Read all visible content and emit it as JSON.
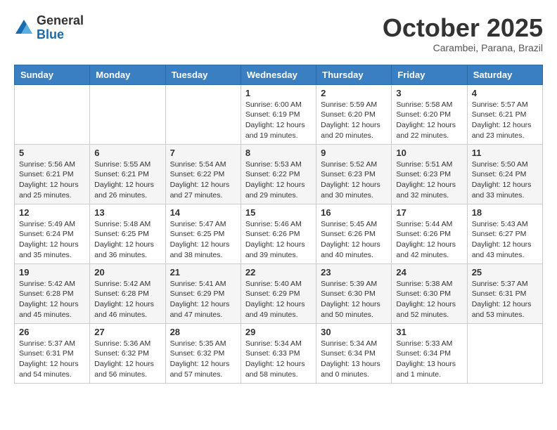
{
  "header": {
    "logo": {
      "general": "General",
      "blue": "Blue"
    },
    "title": "October 2025",
    "location": "Carambei, Parana, Brazil"
  },
  "weekdays": [
    "Sunday",
    "Monday",
    "Tuesday",
    "Wednesday",
    "Thursday",
    "Friday",
    "Saturday"
  ],
  "weeks": [
    [
      {
        "day": "",
        "info": ""
      },
      {
        "day": "",
        "info": ""
      },
      {
        "day": "",
        "info": ""
      },
      {
        "day": "1",
        "info": "Sunrise: 6:00 AM\nSunset: 6:19 PM\nDaylight: 12 hours\nand 19 minutes."
      },
      {
        "day": "2",
        "info": "Sunrise: 5:59 AM\nSunset: 6:20 PM\nDaylight: 12 hours\nand 20 minutes."
      },
      {
        "day": "3",
        "info": "Sunrise: 5:58 AM\nSunset: 6:20 PM\nDaylight: 12 hours\nand 22 minutes."
      },
      {
        "day": "4",
        "info": "Sunrise: 5:57 AM\nSunset: 6:21 PM\nDaylight: 12 hours\nand 23 minutes."
      }
    ],
    [
      {
        "day": "5",
        "info": "Sunrise: 5:56 AM\nSunset: 6:21 PM\nDaylight: 12 hours\nand 25 minutes."
      },
      {
        "day": "6",
        "info": "Sunrise: 5:55 AM\nSunset: 6:21 PM\nDaylight: 12 hours\nand 26 minutes."
      },
      {
        "day": "7",
        "info": "Sunrise: 5:54 AM\nSunset: 6:22 PM\nDaylight: 12 hours\nand 27 minutes."
      },
      {
        "day": "8",
        "info": "Sunrise: 5:53 AM\nSunset: 6:22 PM\nDaylight: 12 hours\nand 29 minutes."
      },
      {
        "day": "9",
        "info": "Sunrise: 5:52 AM\nSunset: 6:23 PM\nDaylight: 12 hours\nand 30 minutes."
      },
      {
        "day": "10",
        "info": "Sunrise: 5:51 AM\nSunset: 6:23 PM\nDaylight: 12 hours\nand 32 minutes."
      },
      {
        "day": "11",
        "info": "Sunrise: 5:50 AM\nSunset: 6:24 PM\nDaylight: 12 hours\nand 33 minutes."
      }
    ],
    [
      {
        "day": "12",
        "info": "Sunrise: 5:49 AM\nSunset: 6:24 PM\nDaylight: 12 hours\nand 35 minutes."
      },
      {
        "day": "13",
        "info": "Sunrise: 5:48 AM\nSunset: 6:25 PM\nDaylight: 12 hours\nand 36 minutes."
      },
      {
        "day": "14",
        "info": "Sunrise: 5:47 AM\nSunset: 6:25 PM\nDaylight: 12 hours\nand 38 minutes."
      },
      {
        "day": "15",
        "info": "Sunrise: 5:46 AM\nSunset: 6:26 PM\nDaylight: 12 hours\nand 39 minutes."
      },
      {
        "day": "16",
        "info": "Sunrise: 5:45 AM\nSunset: 6:26 PM\nDaylight: 12 hours\nand 40 minutes."
      },
      {
        "day": "17",
        "info": "Sunrise: 5:44 AM\nSunset: 6:26 PM\nDaylight: 12 hours\nand 42 minutes."
      },
      {
        "day": "18",
        "info": "Sunrise: 5:43 AM\nSunset: 6:27 PM\nDaylight: 12 hours\nand 43 minutes."
      }
    ],
    [
      {
        "day": "19",
        "info": "Sunrise: 5:42 AM\nSunset: 6:28 PM\nDaylight: 12 hours\nand 45 minutes."
      },
      {
        "day": "20",
        "info": "Sunrise: 5:42 AM\nSunset: 6:28 PM\nDaylight: 12 hours\nand 46 minutes."
      },
      {
        "day": "21",
        "info": "Sunrise: 5:41 AM\nSunset: 6:29 PM\nDaylight: 12 hours\nand 47 minutes."
      },
      {
        "day": "22",
        "info": "Sunrise: 5:40 AM\nSunset: 6:29 PM\nDaylight: 12 hours\nand 49 minutes."
      },
      {
        "day": "23",
        "info": "Sunrise: 5:39 AM\nSunset: 6:30 PM\nDaylight: 12 hours\nand 50 minutes."
      },
      {
        "day": "24",
        "info": "Sunrise: 5:38 AM\nSunset: 6:30 PM\nDaylight: 12 hours\nand 52 minutes."
      },
      {
        "day": "25",
        "info": "Sunrise: 5:37 AM\nSunset: 6:31 PM\nDaylight: 12 hours\nand 53 minutes."
      }
    ],
    [
      {
        "day": "26",
        "info": "Sunrise: 5:37 AM\nSunset: 6:31 PM\nDaylight: 12 hours\nand 54 minutes."
      },
      {
        "day": "27",
        "info": "Sunrise: 5:36 AM\nSunset: 6:32 PM\nDaylight: 12 hours\nand 56 minutes."
      },
      {
        "day": "28",
        "info": "Sunrise: 5:35 AM\nSunset: 6:32 PM\nDaylight: 12 hours\nand 57 minutes."
      },
      {
        "day": "29",
        "info": "Sunrise: 5:34 AM\nSunset: 6:33 PM\nDaylight: 12 hours\nand 58 minutes."
      },
      {
        "day": "30",
        "info": "Sunrise: 5:34 AM\nSunset: 6:34 PM\nDaylight: 13 hours\nand 0 minutes."
      },
      {
        "day": "31",
        "info": "Sunrise: 5:33 AM\nSunset: 6:34 PM\nDaylight: 13 hours\nand 1 minute."
      },
      {
        "day": "",
        "info": ""
      }
    ]
  ]
}
